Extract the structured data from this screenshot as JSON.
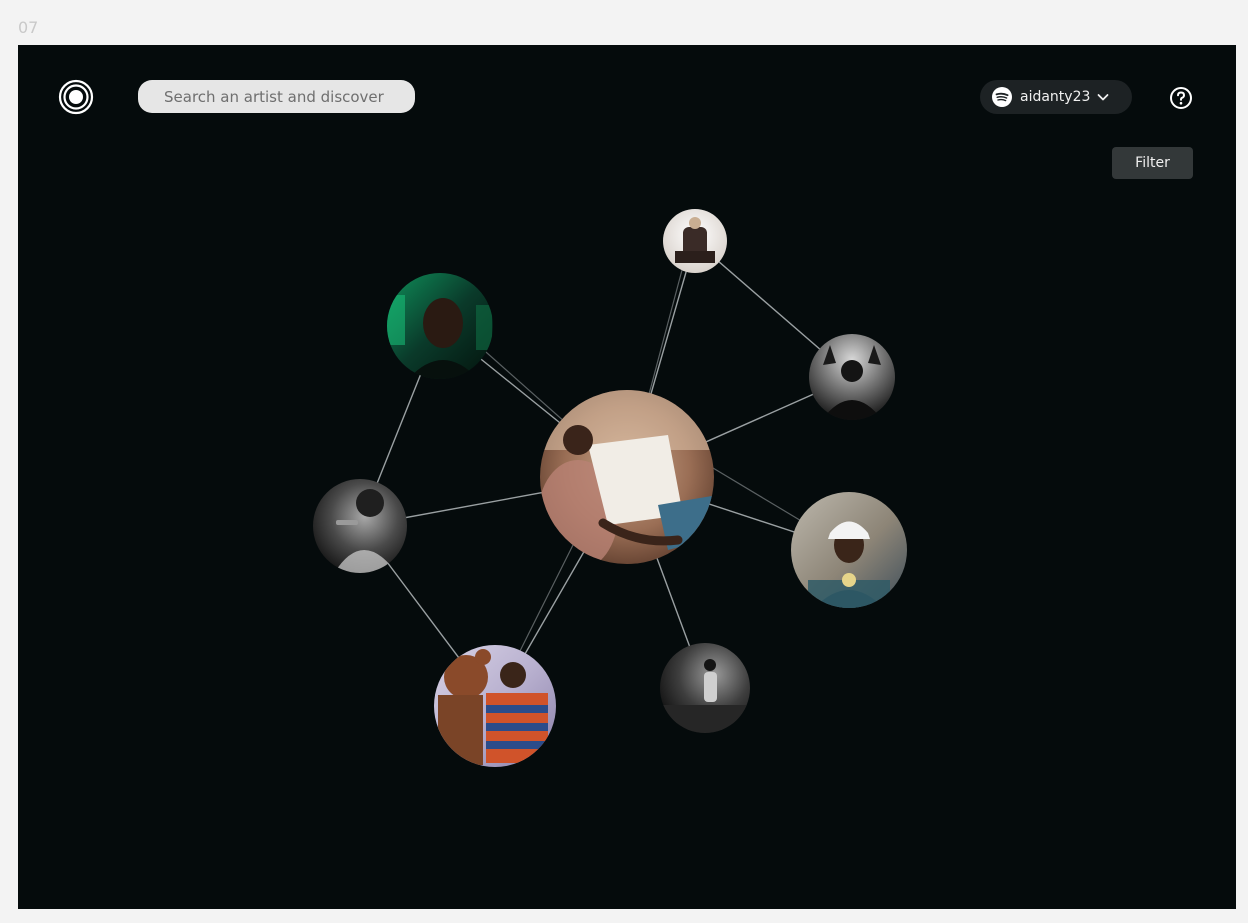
{
  "frame": {
    "label": "07"
  },
  "header": {
    "search_placeholder": "Search an artist and discover",
    "account": {
      "username": "aidanty23",
      "service_icon": "spotify-icon"
    },
    "help_icon": "help-icon"
  },
  "toolbar": {
    "filter_label": "Filter"
  },
  "colors": {
    "background": "#050b0c",
    "search_bg": "#e6e6e6",
    "account_bg": "#1d2224",
    "filter_bg": "#333839"
  },
  "graph": {
    "nodes": [
      {
        "id": "center",
        "name": "artist-node-center"
      },
      {
        "id": "top",
        "name": "artist-node-top"
      },
      {
        "id": "green",
        "name": "artist-node-green-portrait"
      },
      {
        "id": "right-up",
        "name": "artist-node-hands-up"
      },
      {
        "id": "right",
        "name": "artist-node-white-cap"
      },
      {
        "id": "left",
        "name": "artist-node-mic-singer"
      },
      {
        "id": "bottom-left",
        "name": "artist-node-bear-mascot"
      },
      {
        "id": "bottom",
        "name": "artist-node-bw-standing"
      }
    ]
  }
}
